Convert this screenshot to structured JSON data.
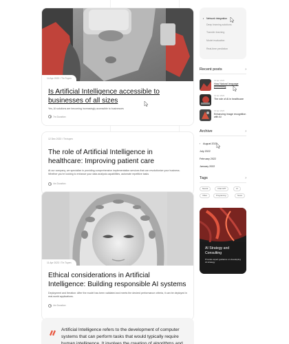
{
  "articles": [
    {
      "meta": "14 Apr 2022 / Tin Tuyen",
      "title": "Is Artificial Intelligence accessible to businesses of all sizes",
      "excerpt": "Yes, AI solutions are becoming increasingly accessible to businesses",
      "read_time": "7m Duration"
    },
    {
      "meta": "12 Dec 2022 / Tin tuyen",
      "title": "The role of Artificial Intelligence in healthcare: Improving patient care",
      "excerpt": "At our company, we specialize in providing comprehensive implementation services that can revolutionize your business. Whether you're looking to enhance your data analysis capabilities, automate repetitive tasks",
      "read_time": "4m Duration"
    },
    {
      "meta": "11 Apr 2023 / Tin Tuyen",
      "title": "Ethical considerations in Artificial Intelligence: Building responsible AI systems",
      "excerpt": "Deployment and Iteration: After the model has been validated and meets the desired performance criteria, it can be deployed in real-world applications.",
      "read_time": "4m Duration"
    }
  ],
  "sidebar": {
    "categories": [
      "Network integration",
      "Deep learning solutions",
      "Transfer learning",
      "Model evaluation",
      "Real-time prediction"
    ],
    "recent_posts_title": "Recent posts",
    "recent_posts": [
      {
        "date": "13 Apr 2023",
        "title": "How Natural language processing"
      },
      {
        "date": "13 Apr 2023",
        "title": "The role of AI in healthcare"
      },
      {
        "date": "13 Apr 2023",
        "title": "Enhancing image recognition with AI"
      }
    ],
    "archive_title": "Archive",
    "archive": [
      "August 2023",
      "July 2022",
      "February 2022",
      "January 2022"
    ],
    "tags_title": "Tags",
    "tags": [
      "Neural",
      "Chat GPT",
      "AI",
      "Video",
      "Programing",
      "News"
    ],
    "promo": {
      "title": "AI Strategy and Consulting",
      "description": "Provide expert guidance on developing AI strategy"
    }
  },
  "info_block": {
    "text": "Artificial Intelligence refers to the development of computer systems that can perform tasks that would typically require human intelligence. It involves the creation of algorithms and models that"
  },
  "colors": {
    "accent": "#e8553d",
    "panel": "#f4f4f4"
  }
}
